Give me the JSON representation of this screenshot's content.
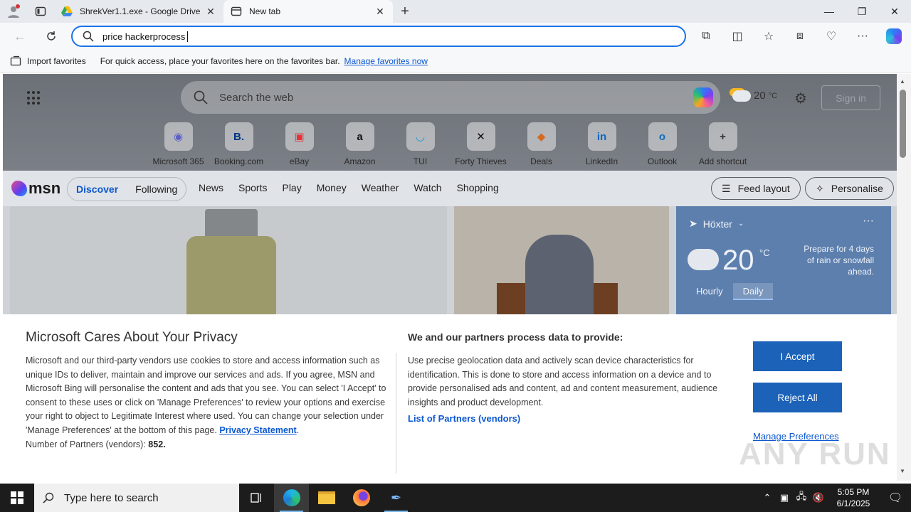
{
  "browser": {
    "tabs": [
      {
        "title": "ShrekVer1.1.exe - Google Drive",
        "icon": "google-drive-icon",
        "active": false
      },
      {
        "title": "New tab",
        "icon": "newtab-page-icon",
        "active": true
      }
    ],
    "address": {
      "value": "price hackerprocess"
    },
    "favorites_bar": {
      "import_label": "Import favorites",
      "message": "For quick access, place your favorites here on the favorites bar.",
      "manage_link": "Manage favorites now"
    }
  },
  "newtab": {
    "search_placeholder": "Search the web",
    "weather_top": {
      "temp": "20",
      "unit": "°C"
    },
    "signin_label": "Sign in",
    "shortcuts": [
      {
        "label": "Microsoft 365",
        "icon": "microsoft365-icon",
        "glyph": "◉",
        "color": "#5b5fc7"
      },
      {
        "label": "Booking.com",
        "icon": "booking-icon",
        "glyph": "B.",
        "color": "#003580"
      },
      {
        "label": "eBay",
        "icon": "ebay-icon",
        "glyph": "▣",
        "color": "#e53238"
      },
      {
        "label": "Amazon",
        "icon": "amazon-icon",
        "glyph": "a",
        "color": "#111111"
      },
      {
        "label": "TUI",
        "icon": "tui-icon",
        "glyph": "◡",
        "color": "#1a9ad6"
      },
      {
        "label": "Forty Thieves",
        "icon": "forty-thieves-icon",
        "glyph": "✕",
        "color": "#111111"
      },
      {
        "label": "Deals",
        "icon": "deals-icon",
        "glyph": "◆",
        "color": "#d36a1f"
      },
      {
        "label": "LinkedIn",
        "icon": "linkedin-icon",
        "glyph": "in",
        "color": "#0a66c2"
      },
      {
        "label": "Outlook",
        "icon": "outlook-icon",
        "glyph": "o",
        "color": "#0f6cbd"
      },
      {
        "label": "Add shortcut",
        "icon": "plus-icon",
        "glyph": "+",
        "color": "#333333"
      }
    ]
  },
  "msn": {
    "logo": "msn",
    "pill": {
      "discover": "Discover",
      "following": "Following"
    },
    "nav": [
      "News",
      "Sports",
      "Play",
      "Money",
      "Weather",
      "Watch",
      "Shopping"
    ],
    "feed_layout": "Feed layout",
    "personalise": "Personalise",
    "weather_card": {
      "location": "Höxter",
      "temp": "20",
      "unit": "°C",
      "forecast": "Prepare for 4 days of rain or snowfall ahead.",
      "tabs": [
        "Hourly",
        "Daily"
      ],
      "selected_tab": "Daily"
    }
  },
  "privacy": {
    "title": "Microsoft Cares About Your Privacy",
    "body": "Microsoft and our third-party vendors use cookies to store and access information such as unique IDs to deliver, maintain and improve our services and ads. If you agree, MSN and Microsoft Bing will personalise the content and ads that you see. You can select 'I Accept' to consent to these uses or click on 'Manage Preferences' to review your options and exercise your right to object to Legitimate Interest where used.  You can change your selection under 'Manage Preferences' at the bottom of this page.",
    "privacy_link": "Privacy Statement",
    "partners_label": "Number of Partners (vendors):",
    "partners_count": "852.",
    "right_title": "We and our partners process data to provide:",
    "right_body": "Use precise geolocation data and actively scan device characteristics for identification. This is done to store and access information on a device and to provide personalised ads and content, ad and content measurement, audience insights and product development.",
    "partners_link": "List of Partners (vendors)",
    "accept": "I Accept",
    "reject": "Reject All",
    "manage": "Manage Preferences"
  },
  "watermark": "ANY RUN",
  "taskbar": {
    "search_placeholder": "Type here to search",
    "time": "5:05 PM",
    "date": "6/1/2025"
  }
}
